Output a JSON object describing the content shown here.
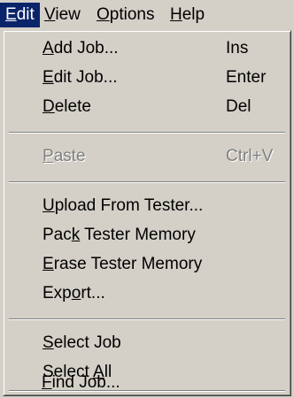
{
  "menubar": {
    "items": [
      {
        "label": "Edit",
        "accel": "E",
        "rest": "dit"
      },
      {
        "label": "View",
        "accel": "V",
        "rest": "iew"
      },
      {
        "label": "Options",
        "accel": "O",
        "rest": "ptions"
      },
      {
        "label": "Help",
        "accel": "H",
        "rest": "elp"
      }
    ]
  },
  "menu": {
    "items": [
      {
        "pre": "",
        "accel": "A",
        "post": "dd Job...",
        "shortcut": "Ins",
        "enabled": true
      },
      {
        "pre": "",
        "accel": "E",
        "post": "dit Job...",
        "shortcut": "Enter",
        "enabled": true
      },
      {
        "pre": "",
        "accel": "D",
        "post": "elete",
        "shortcut": "Del",
        "enabled": true
      },
      {
        "pre": "",
        "accel": "P",
        "post": "aste",
        "shortcut": "Ctrl+V",
        "enabled": false
      },
      {
        "pre": "",
        "accel": "U",
        "post": "pload From Tester...",
        "shortcut": "",
        "enabled": true
      },
      {
        "pre": "Pac",
        "accel": "k",
        "post": " Tester Memory",
        "shortcut": "",
        "enabled": true
      },
      {
        "pre": "",
        "accel": "E",
        "post": "rase Tester Memory",
        "shortcut": "",
        "enabled": true
      },
      {
        "pre": "Exp",
        "accel": "o",
        "post": "rt...",
        "shortcut": "",
        "enabled": true
      },
      {
        "pre": "",
        "accel": "S",
        "post": "elect Job",
        "shortcut": "",
        "enabled": true
      },
      {
        "pre": "Select ",
        "accel": "A",
        "post": "ll",
        "shortcut": "",
        "enabled": true
      },
      {
        "pre": "",
        "accel": "F",
        "post": "ind Job...",
        "shortcut": "",
        "enabled": true
      }
    ]
  },
  "colors": {
    "face": "#d4d0c8",
    "highlight": "#0a246a",
    "disabled": "#808080"
  }
}
